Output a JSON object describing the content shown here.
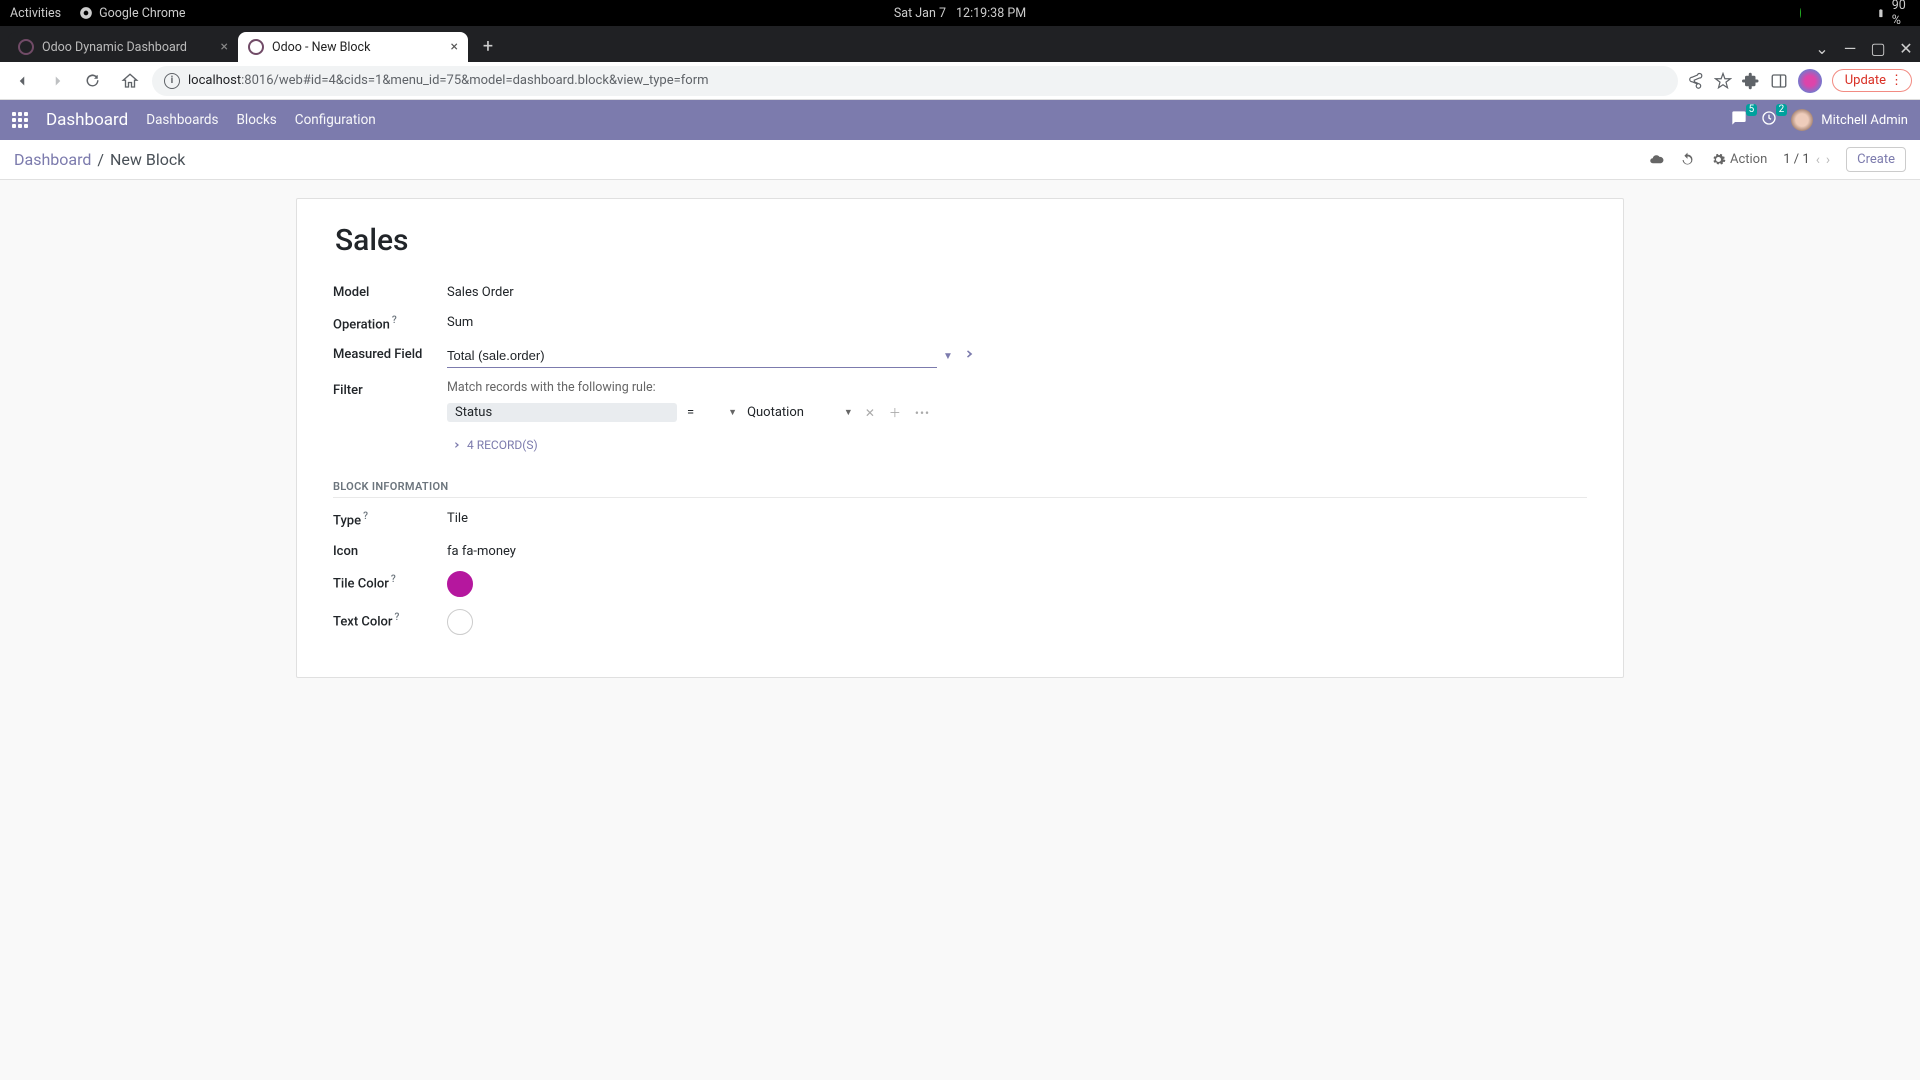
{
  "gnome": {
    "activities": "Activities",
    "app_name": "Google Chrome",
    "date": "Sat Jan 7",
    "time": "12:19:38 PM",
    "battery": "90 %"
  },
  "tabs": [
    {
      "title": "Odoo Dynamic Dashboard",
      "active": false
    },
    {
      "title": "Odoo - New Block",
      "active": true
    }
  ],
  "address": {
    "host": "localhost",
    "path": ":8016/web#id=4&cids=1&menu_id=75&model=dashboard.block&view_type=form"
  },
  "chrome": {
    "update": "Update"
  },
  "odoo_nav": {
    "brand": "Dashboard",
    "menu": [
      "Dashboards",
      "Blocks",
      "Configuration"
    ],
    "msg_count": "5",
    "clock_count": "2",
    "user": "Mitchell Admin"
  },
  "breadcrumb": {
    "root": "Dashboard",
    "sep": "/",
    "current": "New Block",
    "action": "Action",
    "pager": "1 / 1",
    "create": "Create"
  },
  "form": {
    "title": "Sales",
    "labels": {
      "model": "Model",
      "operation": "Operation",
      "measured": "Measured Field",
      "filter": "Filter",
      "type": "Type",
      "icon": "Icon",
      "tile_color": "Tile Color",
      "text_color": "Text Color"
    },
    "values": {
      "model": "Sales Order",
      "operation": "Sum",
      "measured": "Total (sale.order)",
      "filter_desc": "Match records with the following rule:",
      "filter_field": "Status",
      "filter_op": "=",
      "filter_value": "Quotation",
      "records": "4 RECORD(S)",
      "type": "Tile",
      "icon": "fa fa-money",
      "tile_color": "#b5179e",
      "text_color": "#ffffff"
    },
    "section": "BLOCK INFORMATION"
  }
}
